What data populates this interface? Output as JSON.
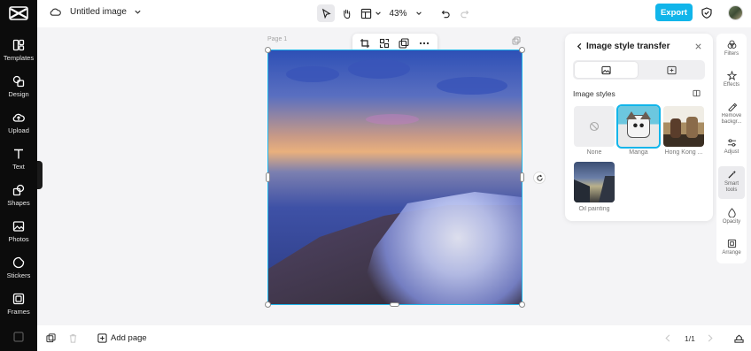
{
  "sidebar": {
    "items": [
      {
        "label": "Templates",
        "icon": "templates-icon"
      },
      {
        "label": "Design",
        "icon": "design-icon"
      },
      {
        "label": "Upload",
        "icon": "upload-icon"
      },
      {
        "label": "Text",
        "icon": "text-icon"
      },
      {
        "label": "Shapes",
        "icon": "shapes-icon"
      },
      {
        "label": "Photos",
        "icon": "photos-icon"
      },
      {
        "label": "Stickers",
        "icon": "stickers-icon"
      },
      {
        "label": "Frames",
        "icon": "frames-icon"
      }
    ]
  },
  "header": {
    "title": "Untitled image",
    "zoom": "43%",
    "export_label": "Export"
  },
  "canvas": {
    "page_label": "Page 1"
  },
  "panel": {
    "title": "Image style transfer",
    "section_label": "Image styles",
    "styles": [
      {
        "name": "None"
      },
      {
        "name": "Manga"
      },
      {
        "name": "Hong Kong ..."
      },
      {
        "name": "Oil painting"
      }
    ]
  },
  "right_tools": [
    {
      "label": "Filters"
    },
    {
      "label": "Effects"
    },
    {
      "label": "Remove backgr..."
    },
    {
      "label": "Adjust"
    },
    {
      "label": "Smart tools"
    },
    {
      "label": "Opacity"
    },
    {
      "label": "Arrange"
    }
  ],
  "footer": {
    "add_page": "Add page",
    "pager": "1/1"
  },
  "colors": {
    "accent": "#11b5ea",
    "sidebar_bg": "#0c0c0c"
  }
}
